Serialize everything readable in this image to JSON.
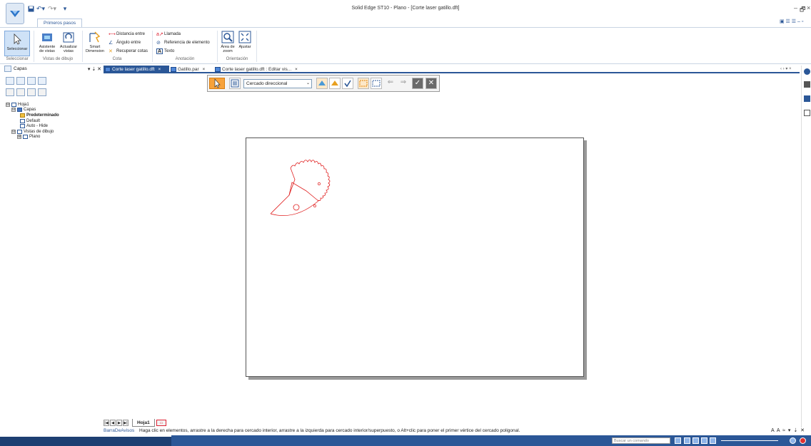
{
  "window": {
    "title": "Solid Edge ST10 - Plano - [Corte laser gatillo.dft]",
    "controls": [
      "–",
      "🗗",
      "×"
    ]
  },
  "quick_access": {
    "items": [
      "save-icon",
      "undo-icon",
      "redo-icon",
      "customize-icon"
    ]
  },
  "ribbon": {
    "active_tab": "Primeros pasos",
    "groups": [
      {
        "name": "Seleccionar"
      },
      {
        "name": "Vistas de dibujo"
      },
      {
        "name": "Cota"
      },
      {
        "name": "Anotación"
      },
      {
        "name": "Orientación"
      }
    ],
    "buttons": {
      "seleccionar": "Seleccionar",
      "asistente": "Asistente de vistas",
      "actualizar": "Actualizar vistas",
      "smart": "Smart Dimension",
      "distancia": "Distancia entre",
      "angulo": "Ángulo entre",
      "recuperar": "Recuperar cotas",
      "llamada": "Llamada",
      "referencia": "Referencia de elemento",
      "texto": "Texto",
      "area_zoom": "Área de zoom",
      "ajustar": "Ajustar"
    }
  },
  "left_pane": {
    "title": "Capas",
    "pin_controls": "▾ ⇣ ✕",
    "tree": [
      {
        "label": "Hoja1",
        "level": 0,
        "toggle": "⊟"
      },
      {
        "label": "Capas",
        "level": 1,
        "toggle": "⊟"
      },
      {
        "label": "Predeterminado",
        "level": 2,
        "bold": true
      },
      {
        "label": "Default",
        "level": 2
      },
      {
        "label": "Auto - Hide",
        "level": 2
      },
      {
        "label": "Vistas de dibujo",
        "level": 1,
        "toggle": "⊟"
      },
      {
        "label": "Plano",
        "level": 2,
        "toggle": "⊞"
      }
    ]
  },
  "doc_tabs": [
    {
      "label": "Corte laser gatillo.dft",
      "active": true,
      "close": "×"
    },
    {
      "label": "Gatillo.par",
      "active": false,
      "close": "×"
    },
    {
      "label": "Corte laser gatillo.dft : Editar vis...",
      "active": false,
      "close": "×"
    }
  ],
  "doc_tabs_right": "‹ › ▾ ×",
  "selection_toolbar": {
    "mode": "Cercado direccional"
  },
  "sheet_tabs": {
    "nav": [
      "|◀",
      "◀",
      "▶",
      "▶|"
    ],
    "active": "Hoja1"
  },
  "status": {
    "source": "BarraDeAvisos",
    "message": "Haga clic en elementos, arrastre a la derecha para cercado interior, arrastre a la izquierda para cercado interior/superpuesto, o Alt+clic para poner el primer vértice del cercado poligonal.",
    "right_controls": "A A ≈ ▾ ⇣ ✕"
  },
  "command_search": {
    "placeholder": "Buscar un comando"
  },
  "colors": {
    "accent": "#2b5797",
    "sketch": "#e02020",
    "select_active": "#f7a23b"
  }
}
